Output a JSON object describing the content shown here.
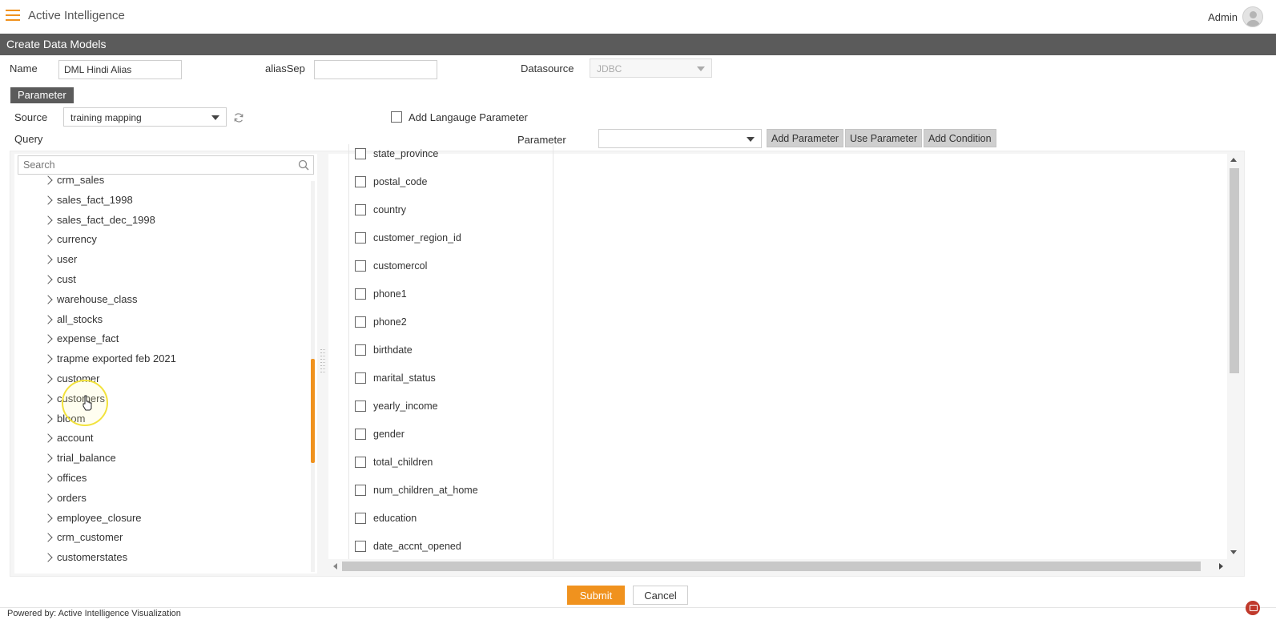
{
  "app": {
    "title": "Active Intelligence",
    "user": "Admin"
  },
  "page": {
    "title": "Create Data Models"
  },
  "form": {
    "name_label": "Name",
    "name_value": "DML Hindi Alias",
    "alias_sep_label": "aliasSep",
    "alias_sep_value": "",
    "datasource_label": "Datasource",
    "datasource_value": "JDBC"
  },
  "parameter_tab": "Parameter",
  "source": {
    "label": "Source",
    "value": "training mapping"
  },
  "language_param": {
    "label": "Add Langauge Parameter",
    "checked": false
  },
  "query": {
    "label": "Query"
  },
  "parameter": {
    "label": "Parameter",
    "value": ""
  },
  "buttons": {
    "add_parameter": "Add Parameter",
    "use_parameter": "Use Parameter",
    "add_condition": "Add Condition",
    "submit": "Submit",
    "cancel": "Cancel"
  },
  "search": {
    "placeholder": "Search"
  },
  "tree_items": [
    "crm_sales",
    "sales_fact_1998",
    "sales_fact_dec_1998",
    "currency",
    "user",
    "cust",
    "warehouse_class",
    "all_stocks",
    "expense_fact",
    "trapme exported feb 2021",
    "customer",
    "customers",
    "bloom",
    "account",
    "trial_balance",
    "offices",
    "orders",
    "employee_closure",
    "crm_customer",
    "customerstates"
  ],
  "columns": [
    "state_province",
    "postal_code",
    "country",
    "customer_region_id",
    "customercol",
    "phone1",
    "phone2",
    "birthdate",
    "marital_status",
    "yearly_income",
    "gender",
    "total_children",
    "num_children_at_home",
    "education",
    "date_accnt_opened"
  ],
  "footer": {
    "powered_by": "Powered by: Active Intelligence Visualization"
  },
  "colors": {
    "accent": "#f0921e",
    "header_bar": "#5b5b5b",
    "button_gray": "#cfcfcf"
  }
}
